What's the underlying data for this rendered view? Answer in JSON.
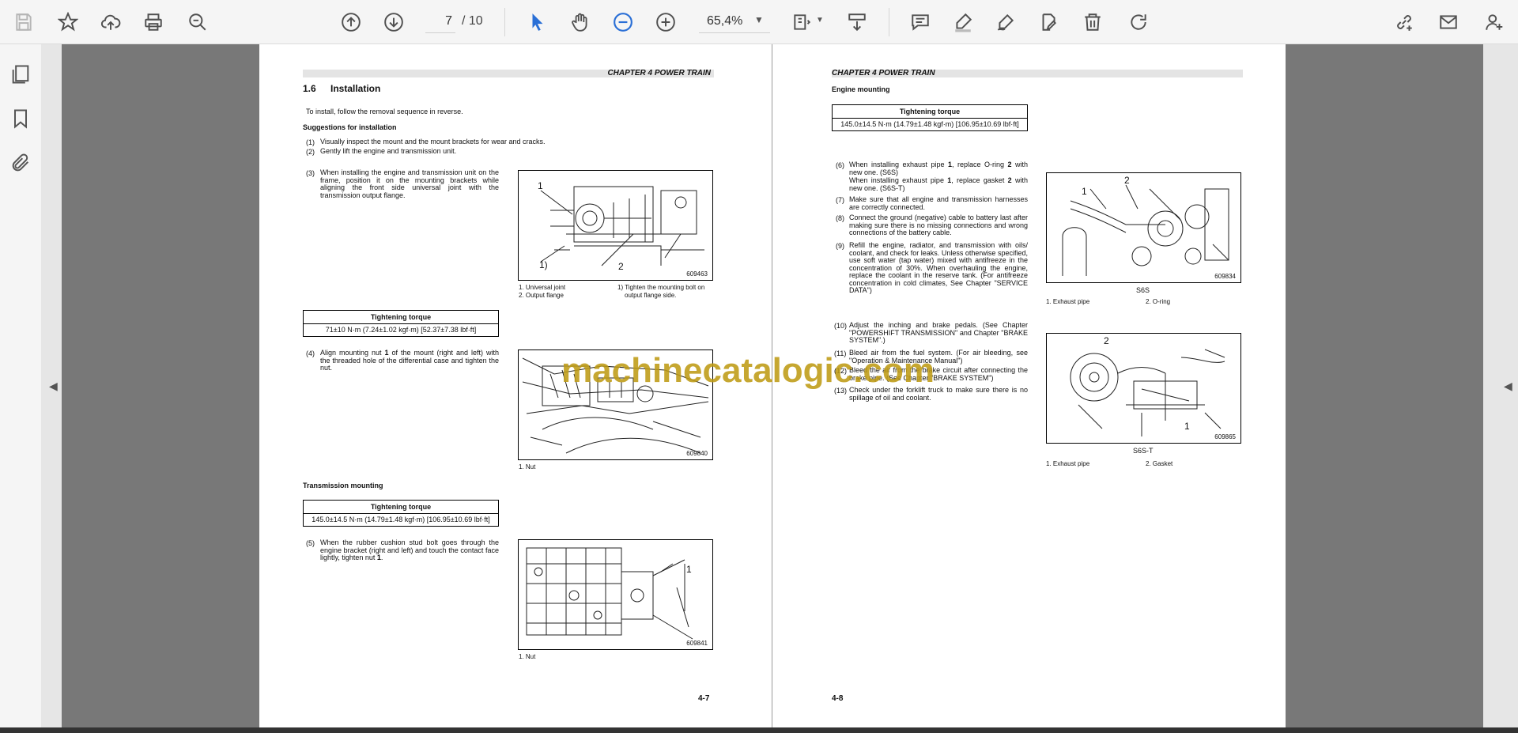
{
  "toolbar": {
    "page_current": "7",
    "page_total": "/ 10",
    "zoom": "65,4%",
    "icons": [
      "save-icon",
      "bookmark-star-icon",
      "upload-icon",
      "print-icon",
      "zoom-search-icon",
      "page-up-icon",
      "page-down-icon",
      "select-cursor-icon",
      "hand-tool-icon",
      "zoom-out-icon",
      "zoom-in-icon",
      "fit-page-icon",
      "scroll-mode-icon",
      "comment-icon",
      "highlight-pen-icon",
      "draw-sign-icon",
      "edit-pdf-icon",
      "delete-icon",
      "rotate-icon",
      "share-link-icon",
      "mail-icon",
      "add-user-icon"
    ]
  },
  "left_page": {
    "chapter": "CHAPTER 4 POWER TRAIN",
    "section_num": "1.6",
    "section_title": "Installation",
    "intro": "To install, follow the removal sequence in reverse.",
    "suggestions_heading": "Suggestions for installation",
    "items": [
      {
        "num": "(1)",
        "text": "Visually inspect the mount and the mount brackets for wear and cracks."
      },
      {
        "num": "(2)",
        "text": "Gently lift the engine and transmission unit."
      },
      {
        "num": "(3)",
        "text": "When installing the engine and transmission unit on the frame, position it on the mounting brackets while aligning the front side universal joint with the transmission output flange."
      }
    ],
    "fig1": {
      "id": "609463",
      "callouts": [
        "1",
        "2",
        "1)"
      ],
      "cap_a1": "1. Universal joint",
      "cap_a2": "2. Output flange",
      "cap_b1": "1) Tighten the mounting bolt on",
      "cap_b2": "output flange side."
    },
    "torque1": {
      "heading": "Tightening torque",
      "value": "71±10 N·m (7.24±1.02 kgf·m) [52.37±7.38 lbf·ft]"
    },
    "item4": {
      "num": "(4)",
      "pre": "Align mounting nut ",
      "bold": "1",
      "post": " of the mount (right and left) with the threaded hole of the differential case and tighten the nut."
    },
    "fig2": {
      "id": "609840",
      "cap": "1. Nut"
    },
    "trans_heading": "Transmission mounting",
    "torque2": {
      "heading": "Tightening torque",
      "value": "145.0±14.5 N·m (14.79±1.48 kgf·m) [106.95±10.69 lbf·ft]"
    },
    "item5": {
      "num": "(5)",
      "pre": "When the rubber cushion stud bolt goes through the engine bracket (right and left) and touch the contact face lightly, tighten nut ",
      "bold": "1",
      "post": "."
    },
    "fig3": {
      "id": "609841",
      "callout": "1",
      "cap": "1. Nut"
    },
    "page_number": "4-7"
  },
  "right_page": {
    "chapter": "CHAPTER 4 POWER TRAIN",
    "heading": "Engine mounting",
    "torque": {
      "heading": "Tightening torque",
      "value": "145.0±14.5 N·m (14.79±1.48 kgf·m) [106.95±10.69 lbf·ft]"
    },
    "item6a": {
      "num": "(6)",
      "pre": "When installing exhaust pipe ",
      "b1": "1",
      "mid": ", replace O-ring ",
      "b2": "2",
      "post": " with new one. (S6S)"
    },
    "item6b": {
      "pre": "When installing exhaust pipe ",
      "b1": "1",
      "mid": ", replace gasket ",
      "b2": "2",
      "post": " with new one. (S6S-T)"
    },
    "items": [
      {
        "num": "(7)",
        "text": "Make sure that all engine and transmission harnesses are correctly connected."
      },
      {
        "num": "(8)",
        "text": "Connect the ground (negative) cable to battery last after making sure there is no missing connections and wrong connections of the battery cable."
      },
      {
        "num": "(9)",
        "text": "Refill the engine, radiator, and transmission with oils/ coolant, and check for leaks. Unless otherwise specified, use soft water (tap water) mixed with antifreeze in the concentration of 30%. When overhauling the engine, replace the coolant in the reserve tank. (For antifreeze concentration in cold climates, See Chapter \"SERVICE DATA\")"
      },
      {
        "num": "(10)",
        "text": "Adjust the inching and brake pedals. (See Chapter \"POWERSHIFT TRANSMISSION\" and Chapter \"BRAKE SYSTEM\".)"
      },
      {
        "num": "(11)",
        "text": "Bleed air from the fuel system. (For air bleeding, see \"Operation & Maintenance Manual\")"
      },
      {
        "num": "(12)",
        "text": "Bleed the air from the brake circuit after connecting the brake pipe. (See Chapter \"BRAKE SYSTEM\")"
      },
      {
        "num": "(13)",
        "text": "Check under the forklift truck to make sure there is no spillage of oil and coolant."
      }
    ],
    "fig4": {
      "id": "609834",
      "title": "S6S",
      "callouts": [
        "1",
        "2"
      ],
      "cap1": "1. Exhaust pipe",
      "cap2": "2. O-ring"
    },
    "fig5": {
      "id": "609865",
      "title": "S6S-T",
      "callouts": [
        "2",
        "1"
      ],
      "cap1": "1. Exhaust pipe",
      "cap2": "2. Gasket"
    },
    "page_number": "4-8"
  },
  "watermark": "machinecatalogic.com"
}
